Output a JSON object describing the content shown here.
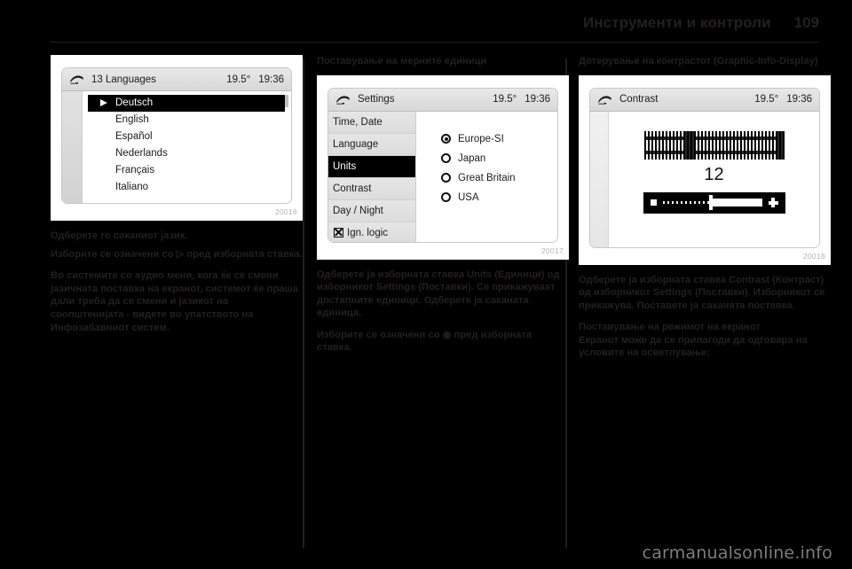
{
  "header": {
    "title": "Инструменти и контроли",
    "page_number": "109"
  },
  "columns": [
    {
      "figure": {
        "number": "20016",
        "device": {
          "icon": "settings-wrench-icon",
          "title": "13 Languages",
          "temperature": "19.5°",
          "clock": "19:36",
          "list": [
            {
              "label": "Deutsch",
              "selected": true
            },
            {
              "label": "English",
              "selected": false
            },
            {
              "label": "Español",
              "selected": false
            },
            {
              "label": "Nederlands",
              "selected": false
            },
            {
              "label": "Français",
              "selected": false
            },
            {
              "label": "Italiano",
              "selected": false
            }
          ]
        }
      },
      "paragraphs": [
        "Одберете го саканиот јазик.",
        "Изборите се означени со ▷ пред изборната ставка.",
        "Во системите со аудио мени, кога ќе се смени јазичната поставка на екранот, системот ќе праша дали треба да се смени и јазикот на соопштенијата - видете во упатството на Инфозабавниот систем."
      ]
    },
    {
      "heading": "Поставување на мерните единици",
      "figure": {
        "number": "20017",
        "device": {
          "icon": "settings-wrench-icon",
          "title": "Settings",
          "temperature": "19.5°",
          "clock": "19:36",
          "menu": [
            {
              "label": "Time, Date",
              "selected": false,
              "icon": null
            },
            {
              "label": "Language",
              "selected": false,
              "icon": null
            },
            {
              "label": "Units",
              "selected": true,
              "icon": null
            },
            {
              "label": "Contrast",
              "selected": false,
              "icon": null
            },
            {
              "label": "Day / Night",
              "selected": false,
              "icon": null
            },
            {
              "label": "Ign. logic",
              "selected": false,
              "icon": "checked-box-icon"
            }
          ],
          "options": [
            {
              "label": "Europe-SI",
              "selected": true
            },
            {
              "label": "Japan",
              "selected": false
            },
            {
              "label": "Great Britain",
              "selected": false
            },
            {
              "label": "USA",
              "selected": false
            }
          ]
        }
      },
      "paragraphs": [
        "Одберете ја изборната ставка Units (Единици) од изборникот Settings (Поставки). Се прикажуваат достапните единици. Одберете ја саканата единица.",
        "Изборите се означени со ◉ пред изборната ставка."
      ]
    },
    {
      "heading": "Дотерување на контрастот (Graphic-Info-Display)",
      "figure": {
        "number": "20018",
        "device": {
          "icon": "settings-wrench-icon",
          "title": "Contrast",
          "temperature": "19.5°",
          "clock": "19:36",
          "value": "12",
          "slider": {
            "minus_label": "minus-icon",
            "plus_label": "plus-icon",
            "position_percent": 48
          }
        }
      },
      "paragraphs": [
        "Одберете ја изборната ставка Contrast (Контраст) од изборникот Settings (Поставки). Изборникот се прикажува. Поставете ја саканата поставка."
      ],
      "subsection": {
        "heading": "Поставување на режимот на екранот",
        "paragraph": "Екранот може да се прилагоди да одговара на условите на осветлување:"
      }
    }
  ],
  "watermark": "carmanualsonline.info"
}
